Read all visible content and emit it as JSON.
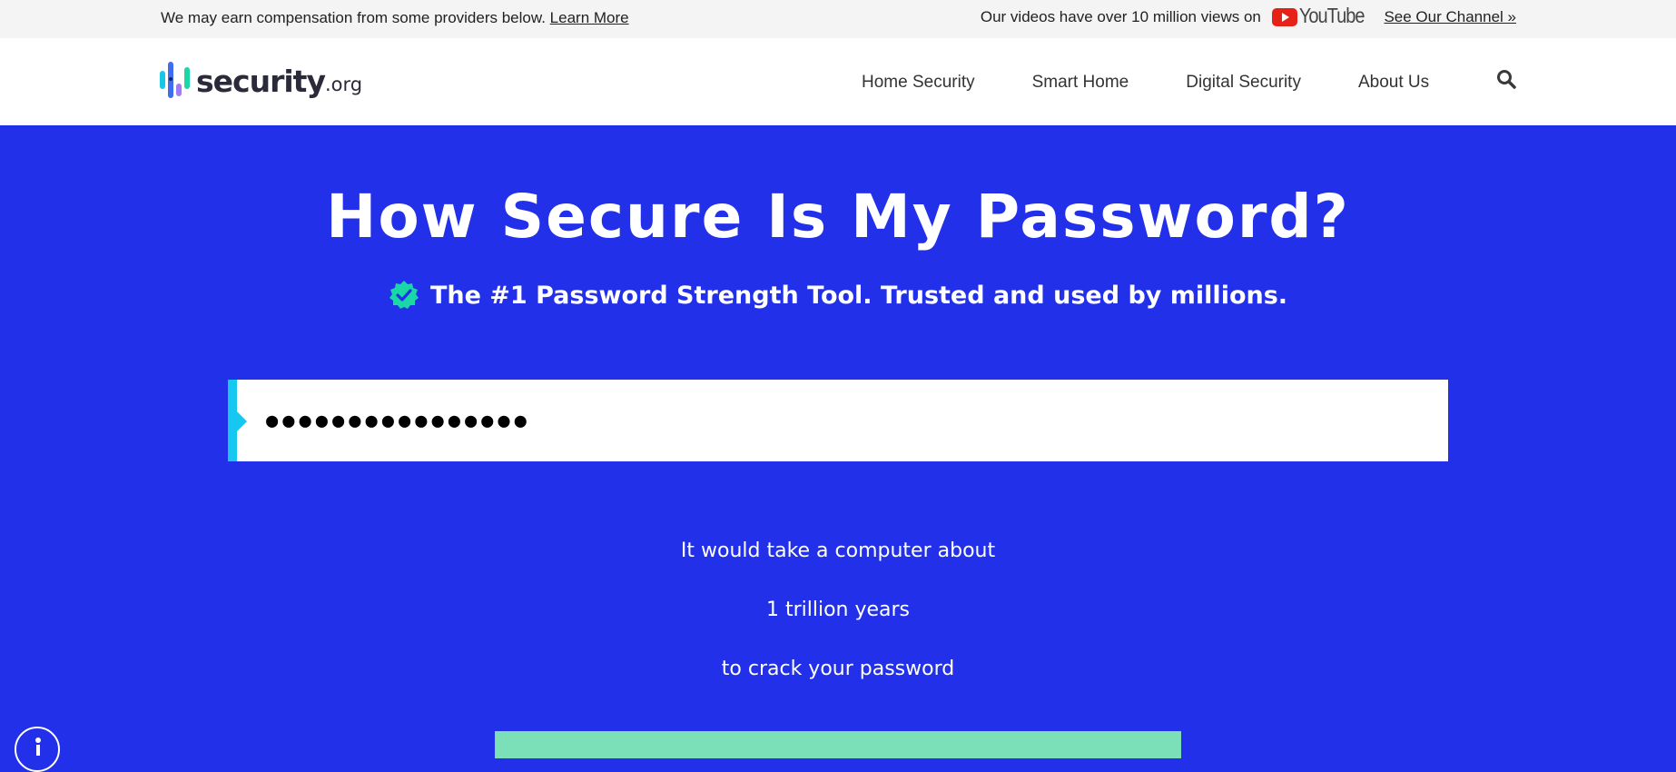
{
  "topbar": {
    "disclosure": "We may earn compensation from some providers below.",
    "learn_more": "Learn More",
    "views": "Our videos have over 10 million views on",
    "youtube": "YouTube",
    "channel_link": "See Our Channel »"
  },
  "header": {
    "logo_name": "security",
    "logo_tld": ".org",
    "nav": [
      "Home Security",
      "Smart Home",
      "Digital Security",
      "About Us"
    ],
    "search_icon": "search-icon"
  },
  "hero": {
    "title": "How Secure Is My Password?",
    "subtitle": "The #1 Password Strength Tool. Trusted and used by millions.",
    "badge_icon": "verified-check-icon",
    "badge_color": "#19d8a6"
  },
  "password": {
    "value": "●●●●●●●●●●●●●●●●"
  },
  "result": {
    "line1": "It would take a computer about",
    "line2": "1 trillion years",
    "line3": "to crack your password"
  },
  "colors": {
    "background": "#2230ea",
    "accent": "#16c8f0",
    "strength": "#7be0b8"
  }
}
